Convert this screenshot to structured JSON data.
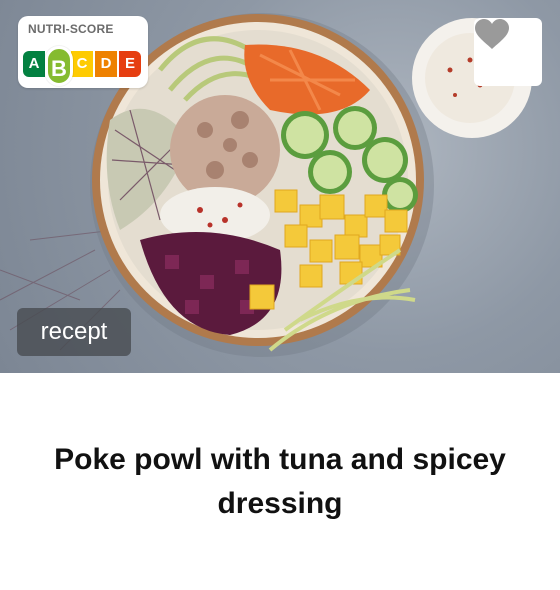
{
  "card": {
    "nutri_score": {
      "label": "NUTRI-SCORE",
      "grades": [
        "A",
        "B",
        "C",
        "D",
        "E"
      ],
      "active": "B",
      "colors": [
        "#038141",
        "#85BB2F",
        "#FECB02",
        "#EE8100",
        "#E63E11"
      ]
    },
    "favorite_icon": "heart-icon",
    "tag": "recept",
    "title": "Poke powl with tuna and spicey dressing"
  }
}
